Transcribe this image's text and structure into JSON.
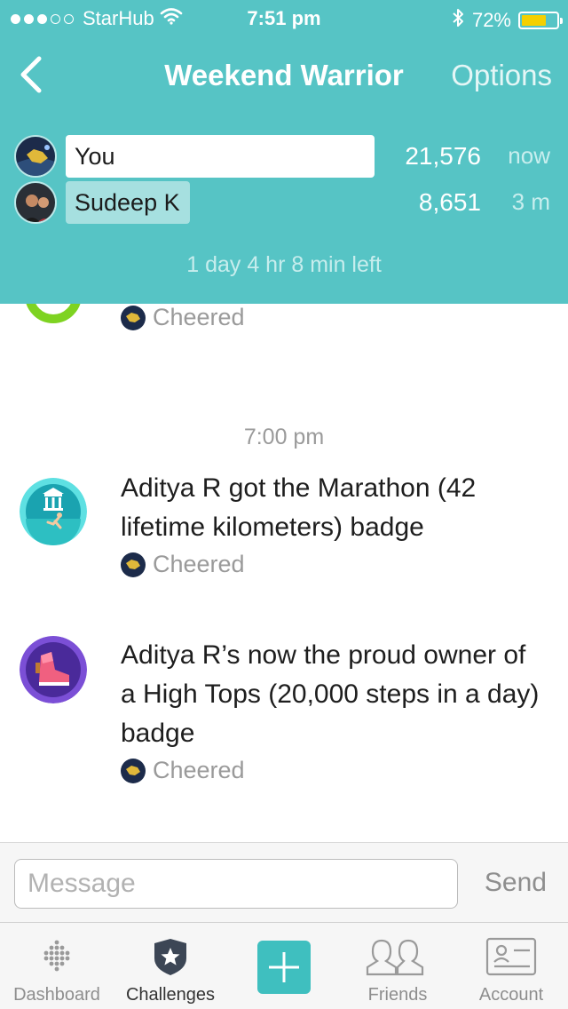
{
  "status_bar": {
    "carrier": "StarHub",
    "time": "7:51 pm",
    "battery": "72%",
    "battery_level": 0.72,
    "signal_bars_filled": 3,
    "signal_bars_total": 5
  },
  "nav": {
    "title": "Weekend Warrior",
    "options_label": "Options",
    "back_icon": "chevron-left-icon"
  },
  "race": {
    "participants": [
      {
        "name": "You",
        "steps": "21,576",
        "updated": "now"
      },
      {
        "name": "Sudeep K",
        "steps": "8,651",
        "updated": "3 m"
      }
    ],
    "time_left": "1 day 4 hr 8 min left"
  },
  "feed": {
    "top_cheer": "Cheered",
    "timestamp": "7:00 pm",
    "items": [
      {
        "text": "Aditya R got the Marathon (42 lifetime kilometers) badge",
        "cheer": "Cheered",
        "badge_icon": "marathon-badge-icon"
      },
      {
        "text": "Aditya R’s now the proud owner of a High Tops (20,000 steps in a day) badge",
        "cheer": "Cheered",
        "badge_icon": "high-tops-badge-icon"
      }
    ]
  },
  "message": {
    "placeholder": "Message",
    "send_label": "Send"
  },
  "tabs": [
    {
      "label": "Dashboard",
      "icon": "dashboard-dots-icon"
    },
    {
      "label": "Challenges",
      "icon": "challenges-star-shield-icon",
      "active": true
    },
    {
      "label": "",
      "icon": "plus-icon"
    },
    {
      "label": "Friends",
      "icon": "friends-icon"
    },
    {
      "label": "Account",
      "icon": "account-card-icon"
    }
  ],
  "colors": {
    "header_teal": "#56c4c5",
    "accent_teal": "#3fbfbf",
    "ring_green": "#7ed321",
    "battery_yellow": "#f5d000"
  }
}
